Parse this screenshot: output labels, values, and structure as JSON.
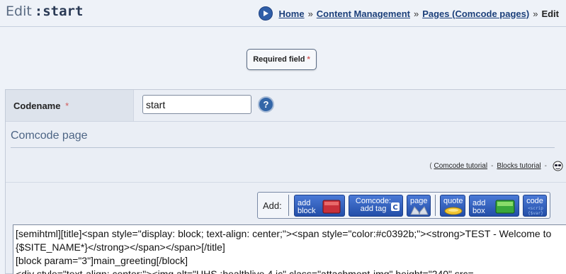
{
  "header": {
    "title_prefix": "Edit",
    "title_code": ":start"
  },
  "breadcrumb": {
    "items": [
      "Home",
      "Content Management",
      "Pages (Comcode pages)"
    ],
    "separator": "»",
    "current": "Edit"
  },
  "required_notice": {
    "label": "Required field",
    "star": "*"
  },
  "form": {
    "codename_label": "Codename",
    "codename_star": "*",
    "codename_value": "start",
    "help_label": "?",
    "section_title": "Comcode page",
    "tutorials": {
      "open": "(",
      "comcode_tutorial": "Comcode tutorial",
      "dash": "-",
      "blocks_tutorial": "Blocks tutorial",
      "close": "-"
    },
    "toolbar": {
      "label": "Add:",
      "buttons": [
        {
          "label": "add block"
        },
        {
          "label": "Comcode: add tag"
        },
        {
          "label": "page"
        },
        {
          "label": "quote"
        },
        {
          "label": "add box"
        },
        {
          "label": "code"
        }
      ]
    },
    "editor_text": "[semihtml][title]<span style=\"display: block; text-align: center;\"><span style=\"color:#c0392b;\"><strong>TEST - Welcome to {$SITE_NAME*}</strong></span></span>[/title]\n[block param=\"3\"]main_greeting[/block]\n<div style=\"text-align: center;\"><img alt=\"UHS :healthlive 4 ic\" class=\"attachment-img\" height=\"240\" src="
  },
  "colors": {
    "accent": "#2f5ea8",
    "link": "#1b3f7a",
    "required_star": "#d25a5a",
    "section_title": "#4d6585"
  }
}
